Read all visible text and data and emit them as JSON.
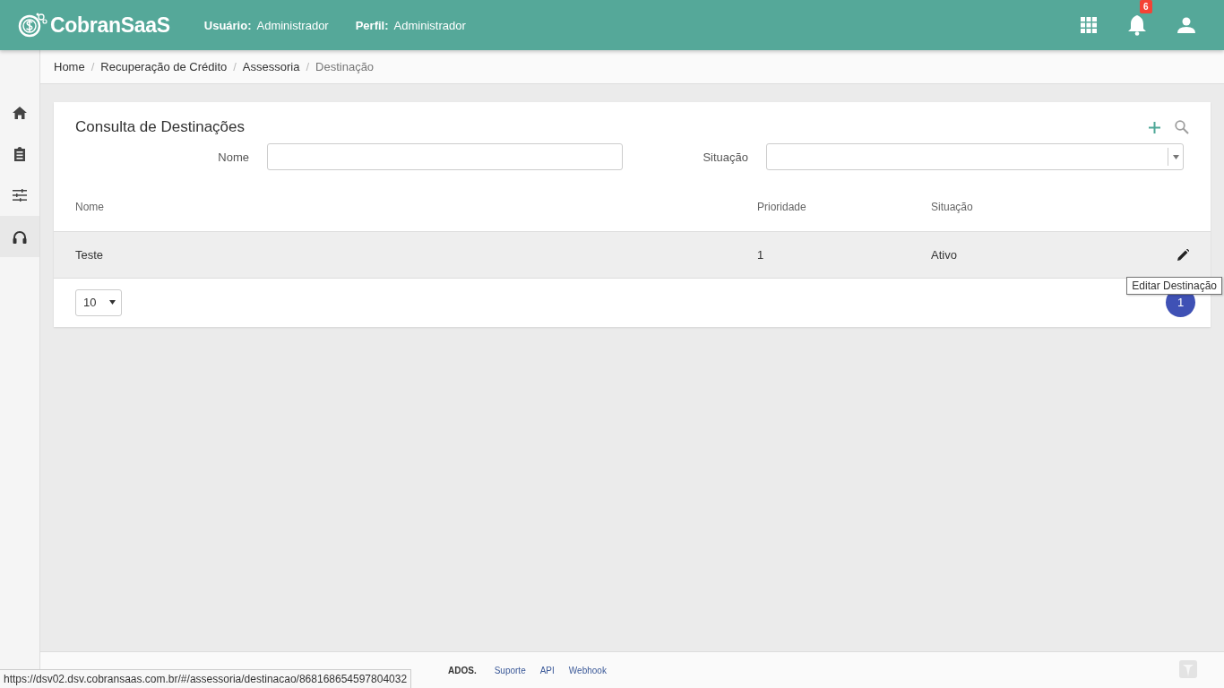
{
  "header": {
    "brand": "CobranSaaS",
    "user_label": "Usuário:",
    "user": "Administrador",
    "profile_label": "Perfil:",
    "profile": "Administrador",
    "notification_count": "6"
  },
  "sidebar": {
    "items": [
      {
        "selected": false
      },
      {
        "selected": false
      },
      {
        "selected": false
      },
      {
        "selected": true
      }
    ]
  },
  "breadcrumb": [
    {
      "kind": "link",
      "text": "Home"
    },
    {
      "kind": "separator",
      "text": "/"
    },
    {
      "kind": "link",
      "text": "Recuperação de Crédito"
    },
    {
      "kind": "separator",
      "text": "/"
    },
    {
      "kind": "link",
      "text": "Assessoria"
    },
    {
      "kind": "separator",
      "text": "/"
    },
    {
      "kind": "current",
      "text": "Destinação"
    }
  ],
  "card": {
    "title": "Consulta de Destinações",
    "filters": [
      {
        "label": "Nome",
        "kind": "text"
      },
      {
        "label": "Situação",
        "kind": "select"
      }
    ],
    "table": {
      "columns": [
        "Nome",
        "Prioridade",
        "Situação"
      ],
      "rows": [
        {
          "cells": [
            "Teste",
            "1",
            "Ativo"
          ],
          "selected": true
        }
      ]
    },
    "tooltip": "Editar Destinação",
    "page_size": "10",
    "pages": [
      {
        "label": "1",
        "selected": true
      }
    ]
  },
  "footer": {
    "text": "ADOS.",
    "links": [
      "Suporte",
      "API",
      "Webhook"
    ]
  },
  "status_url": "https://dsv02.dsv.cobransaas.com.br/#/assessoria/destinacao/868168654597804032"
}
